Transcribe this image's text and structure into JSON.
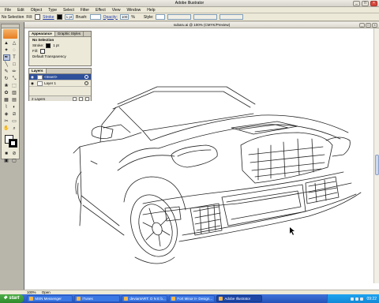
{
  "app": {
    "title": "Adobe Illustrator"
  },
  "menubar": [
    "File",
    "Edit",
    "Object",
    "Type",
    "Select",
    "Filter",
    "Effect",
    "View",
    "Window",
    "Help"
  ],
  "controlbar": {
    "selection": "No Selection",
    "fill_label": "Fill:",
    "stroke_label": "Stroke",
    "stroke_weight": "1 pt",
    "brush_label": "Brush:",
    "opacity_label": "Opacity:",
    "opacity_value": "100",
    "opacity_unit": "%",
    "style_label": "Style:"
  },
  "document": {
    "title": "subaru.ai @ 100% (CMYK/Preview)",
    "zoom": "100%",
    "status": "Open"
  },
  "appearance_panel": {
    "tabs": [
      "Appearance",
      "Graphic Styles"
    ],
    "header": "No Selection",
    "stroke_label": "Stroke:",
    "stroke_value": "1 pt",
    "fill_label": "Fill:",
    "footer": "Default Transparency"
  },
  "layers_panel": {
    "tab": "Layers",
    "layers": [
      {
        "name": "<Insert>",
        "selected": true
      },
      {
        "name": "Layer 1",
        "selected": false
      }
    ],
    "footer": "2 Layers"
  },
  "taskbar": {
    "start_label": "start",
    "tasks": [
      "MSN Messenger",
      "iTunes",
      "deviantART: O N E b...",
      "Fort Minor II- Design...",
      "Adobe Illustrator"
    ],
    "active_task": 4,
    "clock": "09:22"
  },
  "colors": {
    "selection_blue": "#2e4f9a",
    "taskbar_blue": "#2452b8",
    "start_green": "#2f8a2b",
    "illustrator_orange": "#e67e22"
  }
}
